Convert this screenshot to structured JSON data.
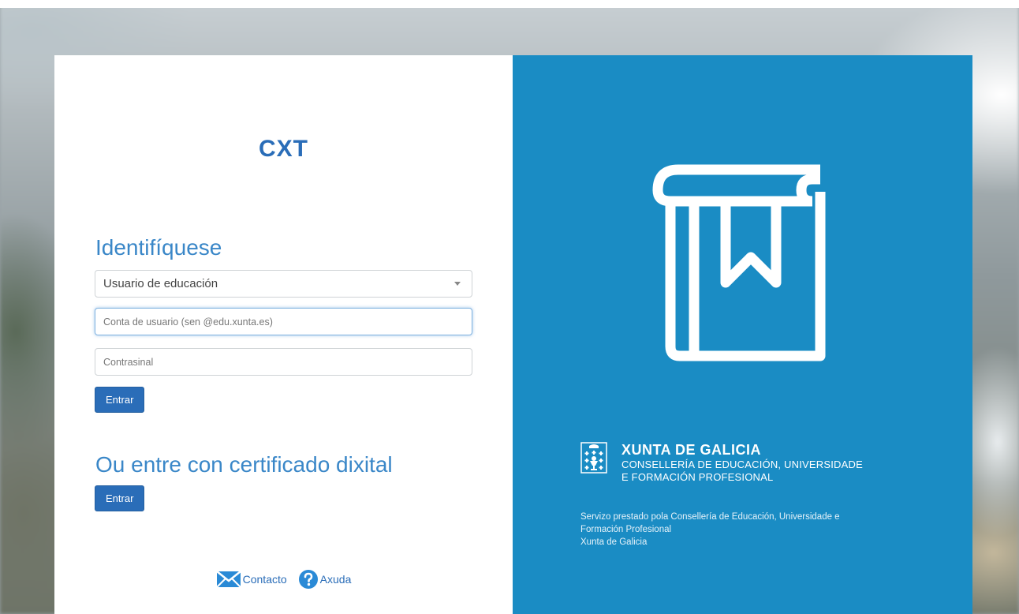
{
  "app": {
    "title": "CXT"
  },
  "login": {
    "heading": "Identifíquese",
    "user_type_selected": "Usuario de educación",
    "username_placeholder": "Conta de usuario (sen @edu.xunta.es)",
    "password_placeholder": "Contrasinal",
    "submit_label": "Entrar"
  },
  "certificate": {
    "heading": "Ou entre con certificado dixital",
    "submit_label": "Entrar"
  },
  "footer": {
    "links": [
      {
        "label": "Contacto",
        "icon": "envelope-icon"
      },
      {
        "label": "Axuda",
        "icon": "help-icon"
      }
    ]
  },
  "branding": {
    "org_name": "XUNTA DE GALICIA",
    "dept_line1": "CONSELLERÍA DE EDUCACIÓN, UNIVERSIDADE",
    "dept_line2": "E FORMACIÓN PROFESIONAL",
    "service_line1": "Servizo prestado pola Consellería de Educación, Universidade e",
    "service_line2": "Formación Profesional",
    "service_line3": "Xunta de Galicia",
    "crest_icon": "xunta-crest-icon",
    "book_icon": "book-bookmark-icon"
  },
  "colors": {
    "primary": "#2a6db8",
    "panel_blue": "#1a8cc4",
    "heading_blue": "#3a87c8"
  }
}
